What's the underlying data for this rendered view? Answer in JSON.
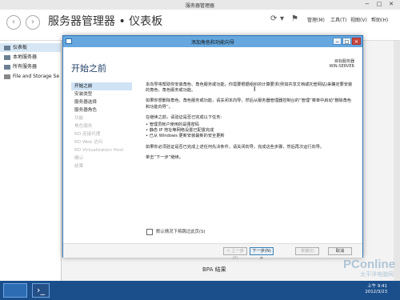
{
  "outer_window": {
    "title": "服务器管理器",
    "breadcrumb": "服务器管理器 • 仪表板",
    "menu": [
      "管理(M)",
      "工具(T)",
      "视图(V)",
      "帮助(H)"
    ]
  },
  "sidebar": {
    "items": [
      {
        "label": "仪表板",
        "active": true
      },
      {
        "label": "本地服务器",
        "active": false
      },
      {
        "label": "所有服务器",
        "active": false
      },
      {
        "label": "File and Storage Se",
        "active": false
      }
    ]
  },
  "background": {
    "bpa_label": "BPA 结果"
  },
  "dialog": {
    "title": "添加角色和功能向导",
    "heading": "开始之前",
    "destination_label": "目标服务器",
    "destination_value": "WIN-SERVER",
    "nav": [
      {
        "label": "开始之前",
        "state": "active"
      },
      {
        "label": "安装类型",
        "state": "normal"
      },
      {
        "label": "服务器选择",
        "state": "normal"
      },
      {
        "label": "服务器角色",
        "state": "normal"
      },
      {
        "label": "功能",
        "state": "disabled"
      },
      {
        "label": "角色服务",
        "state": "disabled"
      },
      {
        "label": "RD 连接代理",
        "state": "disabled"
      },
      {
        "label": "RD Web 访问",
        "state": "disabled"
      },
      {
        "label": "RD Virtualization Host",
        "state": "disabled"
      },
      {
        "label": "确认",
        "state": "disabled"
      },
      {
        "label": "结果",
        "state": "disabled"
      }
    ],
    "body": {
      "p1": "本向导将帮助你安装角色、角色服务或功能。你需要根据组织的计算要求(例如共享文档或托管网站)来确定要安装的角色、角色服务或功能。",
      "p2": "如果你想删除角色、角色服务或功能，请关闭本向导，然后从服务器管理器控制台的“管理”菜单中启动“删除角色和功能向导”。",
      "p3": "在继续之前，请验证是否已完成以下任务:",
      "bullets": [
        "管理员帐户使用的是强密码",
        "静态 IP 地址等网络设置已配置完成",
        "已从 Windows 更新安装最新的安全更新"
      ],
      "p4": "如果你必须验证是否已完成上述任何先决条件，请关闭向导，完成这些步骤，然后再次运行向导。",
      "p5": "单击“下一步”继续。"
    },
    "skip_checkbox_label": "默认情况下将跳过此页(S)",
    "buttons": {
      "prev": "< 上一步(P)",
      "next": "下一步(N) >",
      "install": "安装(I)",
      "cancel": "取消"
    }
  },
  "taskbar": {
    "time": "上午 9:41",
    "date": "2012/3/23"
  },
  "watermark": {
    "brand": "PConline",
    "sub": "太平洋电脑网"
  },
  "colors": {
    "dialog_titlebar": "#65a7de",
    "nav_active": "#cfe3f5",
    "taskbar": "#1b4f8c"
  }
}
